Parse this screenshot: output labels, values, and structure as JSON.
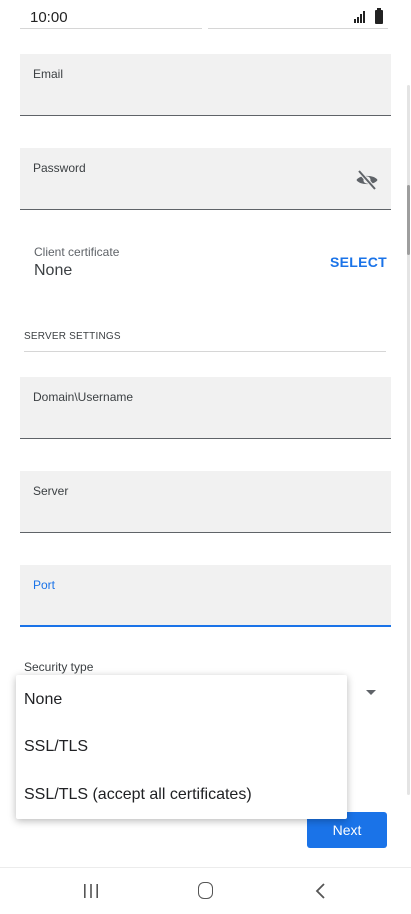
{
  "status_bar": {
    "time": "10:00",
    "signal_icon": "signal-icon",
    "battery_icon": "battery-icon"
  },
  "form": {
    "email_label": "Email",
    "password_label": "Password",
    "password_visibility_icon": "eye-off-icon",
    "client_certificate_label": "Client certificate",
    "client_certificate_value": "None",
    "select_label": "SELECT",
    "server_settings_header": "SERVER SETTINGS",
    "domain_username_label": "Domain\\Username",
    "server_label": "Server",
    "port_label": "Port",
    "security_type_label": "Security type"
  },
  "security_type_dropdown": {
    "options": [
      "None",
      "SSL/TLS",
      "SSL/TLS (accept all certificates)"
    ]
  },
  "actions": {
    "next_label": "Next"
  },
  "nav_bar": {
    "recents_icon": "recents-icon",
    "home_icon": "home-icon",
    "back_icon": "back-icon"
  },
  "colors": {
    "accent": "#1a73e8",
    "field_background": "#f1f1f1"
  }
}
